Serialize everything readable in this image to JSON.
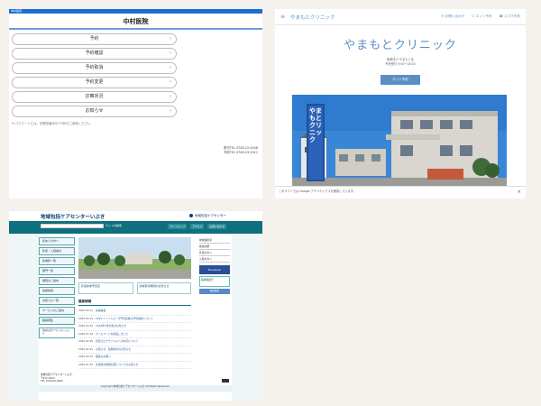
{
  "panel1": {
    "topbar_label": "中村医院",
    "title": "中村医院",
    "menu": [
      "予約",
      "予約確認",
      "予約取消",
      "予約変更",
      "診察状況",
      "お知らせ"
    ],
    "note": "※ パスワードには、診察券番号の下4桁をご使用ください",
    "tel_lines": [
      "受付TEL 0748-22-0008",
      "予約TEL 0748-23-2011"
    ]
  },
  "panel2": {
    "brand": "やまもとクリニック",
    "nav_links": [
      "お問い合わせ",
      "ネット予約",
      "スマホ予約"
    ],
    "clinic_name": "やまもとクリニック",
    "addr_lines": [
      "医療法人 やまもと会",
      "外来受付 9:00〜18:00"
    ],
    "reserve_label": "ネット予約",
    "sign_text": "やまもとクリニック",
    "cookie_notice": "このサイトでは Google アナリティクスを使用しています。"
  },
  "panel3": {
    "site_title": "地域包括ケアセンターいぶき",
    "logo_text": "地域包括ケアセンター",
    "search_btn": "サイト内検索",
    "toolbar": [
      "サイトマップ",
      "アクセス",
      "お問い合わせ"
    ],
    "side_menu": [
      "初めての方へ",
      "外来・入院案内",
      "診療科一覧",
      "部門一覧",
      "病院のご案内",
      "採用情報",
      "お知らせ一覧",
      "サービスのご案内",
      "職員募集"
    ],
    "side_card": "地域包括ケアセンターいぶき",
    "promos": [
      "外来診療予定表",
      "診療受付時間のお知らせ"
    ],
    "news_header": "最新情報",
    "news": [
      {
        "date": "2020.04.01",
        "title": "病棟看護"
      },
      {
        "date": "2020.03.24",
        "title": "2020 インフルエンザ予防接種の予約開始について"
      },
      {
        "date": "2020.03.20",
        "title": "2020年3月外来のお知らせ"
      },
      {
        "date": "2020.03.16",
        "title": "ホームページを開設しました"
      },
      {
        "date": "2020.02.28",
        "title": "新型コロナウイルスへの対応について"
      },
      {
        "date": "2020.02.15",
        "title": "お知らせ：臨時休診のお知らせ"
      },
      {
        "date": "2020.02.04",
        "title": "面会のお願い"
      },
      {
        "date": "2020.01.30",
        "title": "診療受付時間変更についてのお知らせ"
      }
    ],
    "right_links": [
      "地域連携室",
      "健康診断",
      "外来の方へ",
      "入院の方へ"
    ],
    "right_fb": "Facebook",
    "right_sub": "医療相談室",
    "right_blue": "職員募集",
    "footer_lines": [
      "地域包括ケアセンターいぶき",
      "〒521-0000",
      "TEL 0749-00-0000"
    ],
    "footer_bar": "Copyright 地域包括ケアセンターいぶき All Rights Reserved."
  },
  "colors": {
    "blue_bar": "#1d6fd1",
    "clinic_blue": "#5b8fc4",
    "teal": "#0e6f7e"
  }
}
